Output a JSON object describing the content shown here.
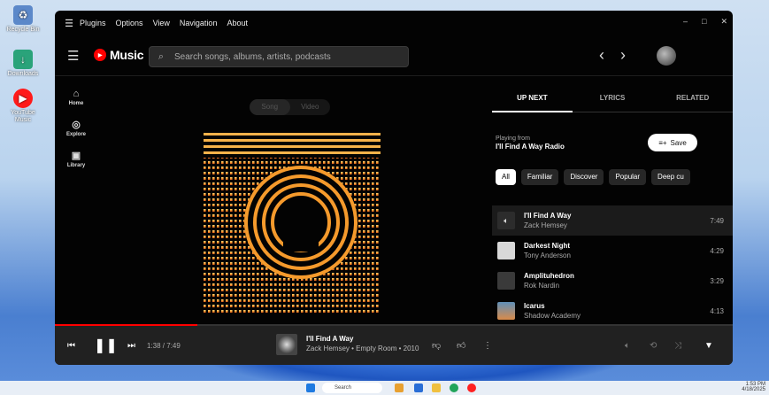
{
  "desktop": {
    "icons": [
      {
        "name": "recycle-bin-icon",
        "label": "Recycle Bin"
      },
      {
        "name": "downloads-folder-icon",
        "label": "Downloads"
      },
      {
        "name": "youtube-music-desktop-icon",
        "label": "YouTube Music"
      }
    ]
  },
  "window": {
    "menu": [
      "Plugins",
      "Options",
      "View",
      "Navigation",
      "About"
    ],
    "controls": {
      "minimize": "–",
      "maximize": "□",
      "close": "✕"
    }
  },
  "topbar": {
    "logo_text": "Music",
    "search_placeholder": "Search songs, albums, artists, podcasts"
  },
  "sidebar": {
    "items": [
      {
        "label": "Home",
        "icon": "home-icon"
      },
      {
        "label": "Explore",
        "icon": "compass-icon"
      },
      {
        "label": "Library",
        "icon": "library-icon"
      }
    ]
  },
  "main": {
    "toggle": {
      "song": "Song",
      "video": "Video"
    }
  },
  "panel": {
    "tabs": [
      "UP NEXT",
      "LYRICS",
      "RELATED"
    ],
    "playing_from_label": "Playing from",
    "playing_from_value": "I'll Find A Way Radio",
    "save_label": "Save",
    "chips": [
      "All",
      "Familiar",
      "Discover",
      "Popular",
      "Deep cu"
    ],
    "queue": [
      {
        "title": "I'll Find A Way",
        "artist": "Zack Hemsey",
        "duration": "7:49",
        "current": true
      },
      {
        "title": "Darkest Night",
        "artist": "Tony Anderson",
        "duration": "4:29"
      },
      {
        "title": "Amplituhedron",
        "artist": "Rok Nardin",
        "duration": "3:29"
      },
      {
        "title": "Icarus",
        "artist": "Shadow Academy",
        "duration": "4:13"
      }
    ]
  },
  "player": {
    "time": "1:38 / 7:49",
    "progress": 0.21,
    "title": "I'll Find A Way",
    "subtitle": "Zack Hemsey • Empty Room • 2010"
  },
  "taskbar": {
    "search_label": "Search",
    "time": "1:53 PM",
    "date": "4/18/2025"
  },
  "colors": {
    "accent": "#ff0000",
    "art_orange": "#f7a233"
  }
}
